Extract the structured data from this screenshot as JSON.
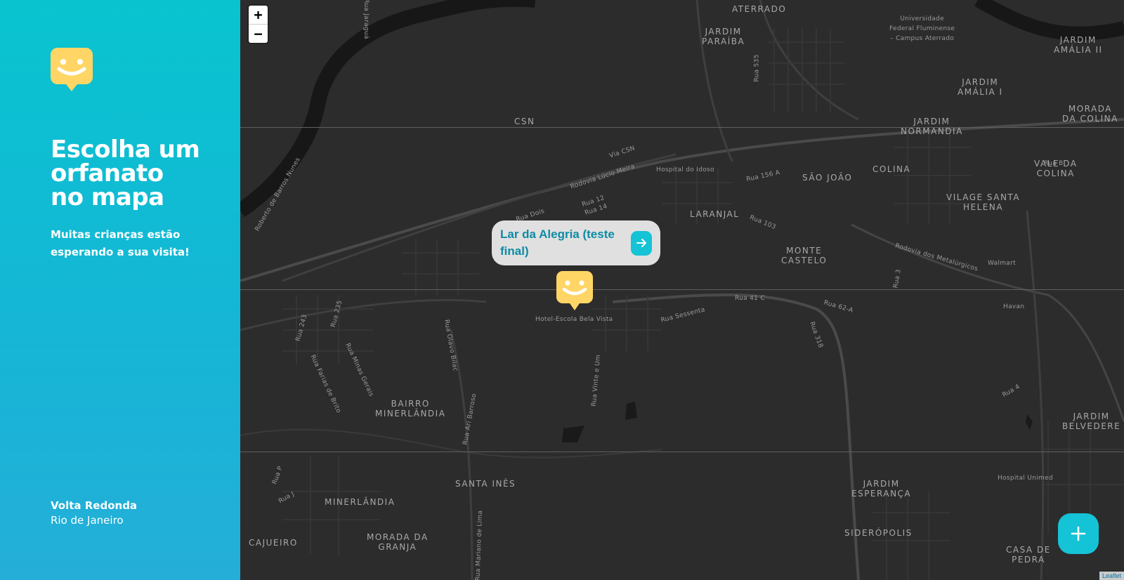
{
  "sidebar": {
    "title": "Escolha um\norfanato\nno mapa",
    "subtitle": "Muitas crianças estão esperando a sua visita!",
    "city": "Volta Redonda",
    "state": "Rio de Janeiro",
    "logo_icon": "happy-face-logo-icon",
    "logo_color": "#FFD666"
  },
  "map": {
    "zoom_in": "+",
    "zoom_out": "−",
    "popup": {
      "name": "Lar da Alegria (teste final)",
      "icon": "arrow-right-icon"
    },
    "attribution": "Leaflet",
    "add_icon": "plus-icon",
    "accent": "#15C3D6",
    "labels": [
      {
        "text": "ATERRADO"
      },
      {
        "text": "Universidade\nFederal Fluminense\n– Campus Aterrado"
      },
      {
        "text": "JARDIM\nPARAÍBA"
      },
      {
        "text": "JARDIM\nAMÁLIA II"
      },
      {
        "text": "JARDIM\nAMÁLIA I"
      },
      {
        "text": "MORADA\nDA COLINA"
      },
      {
        "text": "JARDIM\nNORMANDIA"
      },
      {
        "text": "CSN"
      },
      {
        "text": "Via CSN"
      },
      {
        "text": "Hospital do Idoso"
      },
      {
        "text": "Rodovia Lúcio Meira"
      },
      {
        "text": "SÃO JOÃO"
      },
      {
        "text": "COLINA"
      },
      {
        "text": "VALE DA\nCOLINA"
      },
      {
        "text": "VILAGE SANTA\nHELENA"
      },
      {
        "text": "LARANJAL"
      },
      {
        "text": "MONTE\nCASTELO"
      },
      {
        "text": "Rodovia dos Metalúrgicos"
      },
      {
        "text": "Walmart"
      },
      {
        "text": "Havan"
      },
      {
        "text": "Rua Sessenta"
      },
      {
        "text": "Rua 41 C"
      },
      {
        "text": "Rua 62-A"
      },
      {
        "text": "Hotel-Escola Bela Vista"
      },
      {
        "text": "BAIRRO\nMINERLÂNDIA"
      },
      {
        "text": "SANTA INÊS"
      },
      {
        "text": "MINERLÂNDIA"
      },
      {
        "text": "CAJUEIRO"
      },
      {
        "text": "MORADA DA\nGRANJA"
      },
      {
        "text": "JARDIM\nESPERANÇA"
      },
      {
        "text": "SIDERÓPOLIS"
      },
      {
        "text": "CASA DE\nPEDRA"
      },
      {
        "text": "Hospital Unimed"
      },
      {
        "text": "JARDIM\nBELVEDERE"
      },
      {
        "text": "Rua Dois"
      },
      {
        "text": "Rua 12"
      },
      {
        "text": "Rua 14"
      },
      {
        "text": "Rua 156 A"
      },
      {
        "text": "Rua 103"
      },
      {
        "text": "Rua 535"
      },
      {
        "text": "Rua 243"
      },
      {
        "text": "Rua 235"
      },
      {
        "text": "Rua Minas Gerais"
      },
      {
        "text": "Rua Farias de Brito"
      },
      {
        "text": "Rua Olavo Bilac"
      },
      {
        "text": "Rua Ari Barroso"
      },
      {
        "text": "Rua Vinte e Um"
      },
      {
        "text": "Rua 318"
      },
      {
        "text": "Rua B"
      },
      {
        "text": "Rua 4"
      },
      {
        "text": "Rua P"
      },
      {
        "text": "Rua J"
      },
      {
        "text": "Rua 3"
      },
      {
        "text": "Rua Jaraguá"
      },
      {
        "text": "Roberto de Barros Nunes"
      },
      {
        "text": "Rua Mariano de Lima"
      }
    ]
  }
}
